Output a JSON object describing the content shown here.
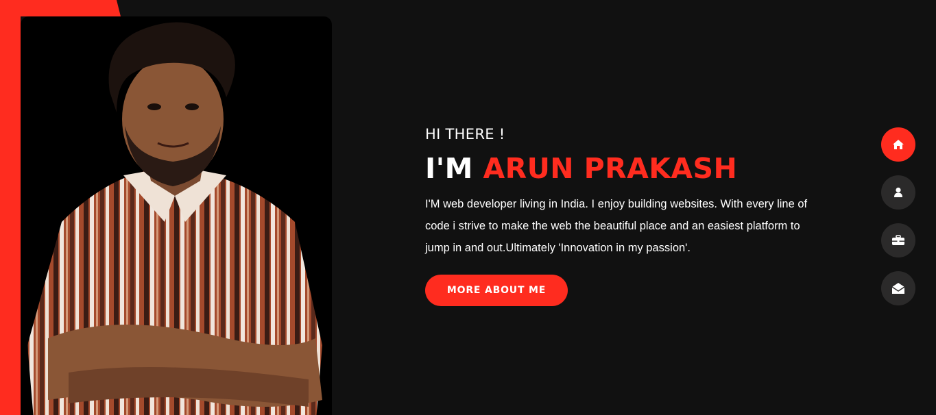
{
  "hero": {
    "greeting": "HI THERE !",
    "prefix": "I'M",
    "name": "ARUN PRAKASH",
    "intro": "I'M web developer living in India. I enjoy building websites. With every line of code i strive to make the web the beautiful place and an easiest platform to jump in and out.Ultimately 'Innovation in my passion'.",
    "cta_label": "MORE ABOUT ME"
  },
  "nav": {
    "items": [
      {
        "icon": "home-icon",
        "active": true
      },
      {
        "icon": "user-icon",
        "active": false
      },
      {
        "icon": "briefcase-icon",
        "active": false
      },
      {
        "icon": "envelope-open-icon",
        "active": false
      }
    ]
  },
  "colors": {
    "accent": "#ff2c1f",
    "background": "#111111",
    "nav_button": "#2b2a2a",
    "text": "#ffffff"
  }
}
